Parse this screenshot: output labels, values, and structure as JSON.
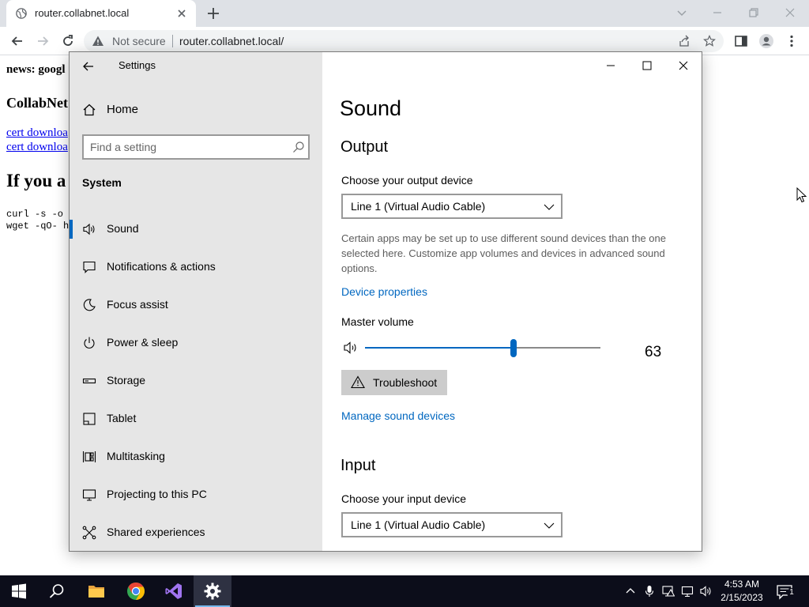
{
  "browser": {
    "tab_title": "router.collabnet.local",
    "security_label": "Not secure",
    "url": "router.collabnet.local/"
  },
  "webpage": {
    "news_line": "news: googl",
    "brand_heading": "CollabNet",
    "links": [
      "cert downloa",
      "cert downloa"
    ],
    "heading": "If you a",
    "code_lines": [
      "curl -s -o",
      "wget -qO- h"
    ]
  },
  "settings": {
    "window_title": "Settings",
    "home_label": "Home",
    "search_placeholder": "Find a setting",
    "category": "System",
    "nav_items": [
      {
        "label": "Sound",
        "icon": "speaker-icon",
        "selected": true
      },
      {
        "label": "Notifications & actions",
        "icon": "message-icon",
        "selected": false
      },
      {
        "label": "Focus assist",
        "icon": "moon-icon",
        "selected": false
      },
      {
        "label": "Power & sleep",
        "icon": "power-icon",
        "selected": false
      },
      {
        "label": "Storage",
        "icon": "storage-icon",
        "selected": false
      },
      {
        "label": "Tablet",
        "icon": "tablet-icon",
        "selected": false
      },
      {
        "label": "Multitasking",
        "icon": "multitasking-icon",
        "selected": false
      },
      {
        "label": "Projecting to this PC",
        "icon": "projector-icon",
        "selected": false
      },
      {
        "label": "Shared experiences",
        "icon": "share-icon",
        "selected": false
      }
    ],
    "page_title": "Sound",
    "output": {
      "heading": "Output",
      "choose_label": "Choose your output device",
      "device": "Line 1 (Virtual Audio Cable)",
      "description": "Certain apps may be set up to use different sound devices than the one selected here. Customize app volumes and devices in advanced sound options.",
      "device_properties_link": "Device properties",
      "master_volume_label": "Master volume",
      "volume": 63,
      "troubleshoot_label": "Troubleshoot",
      "manage_devices_link": "Manage sound devices"
    },
    "input": {
      "heading": "Input",
      "choose_label": "Choose your input device",
      "device": "Line 1 (Virtual Audio Cable)"
    }
  },
  "taskbar": {
    "time": "4:53 AM",
    "date": "2/15/2023",
    "notification_count": "1"
  },
  "colors": {
    "accent": "#0067c0",
    "taskbar": "#0c0d1a",
    "sidebar": "#e6e6e6"
  }
}
